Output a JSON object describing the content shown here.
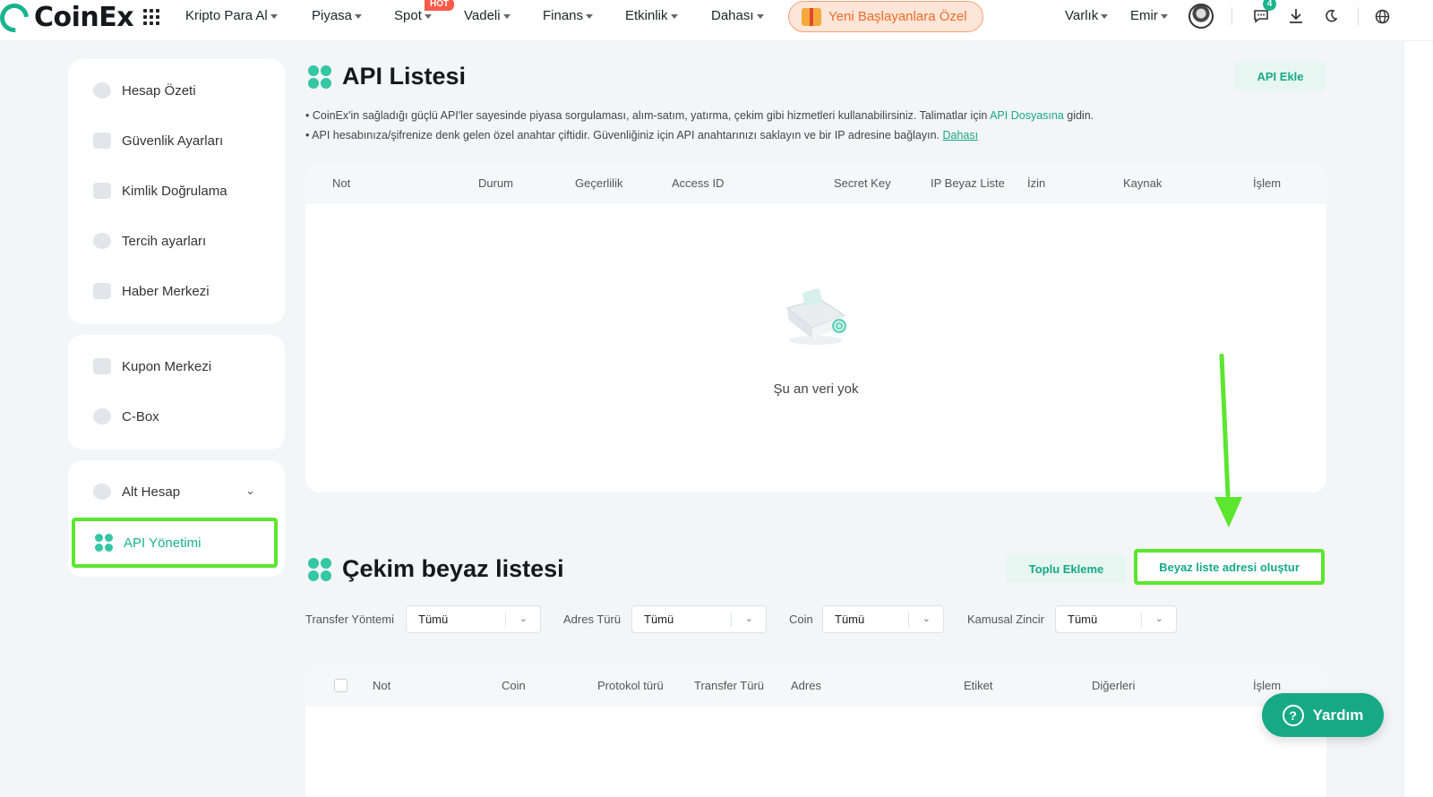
{
  "brand": {
    "name": "CoinEx",
    "accent": "#19b48e",
    "highlight": "#5be630"
  },
  "nav": {
    "items": [
      "Kripto Para Al",
      "Piyasa",
      "Spot",
      "Vadeli",
      "Finans",
      "Etkinlik",
      "Dahası"
    ],
    "hot_badge": "HOT",
    "promo": "Yeni Başlayanlara Özel",
    "asset": "Varlık",
    "order": "Emir",
    "notification_count": "4"
  },
  "sidebar": {
    "group1": [
      "Hesap Özeti",
      "Güvenlik Ayarları",
      "Kimlik Doğrulama",
      "Tercih ayarları",
      "Haber Merkezi"
    ],
    "group2": [
      "Kupon Merkezi",
      "C-Box"
    ],
    "subaccount": "Alt Hesap",
    "active": "API Yönetimi"
  },
  "api_list": {
    "title": "API Listesi",
    "add_button": "API Ekle",
    "info1_prefix": "• CoinEx'in sağladığı güçlü API'ler sayesinde piyasa sorgulaması, alım-satım, yatırma, çekim gibi hizmetleri kullanabilirsiniz. Talimatlar için ",
    "info1_link": "API Dosyasına",
    "info1_suffix": " gidin.",
    "info2_prefix": "• API hesabınıza/şifrenize denk gelen özel anahtar çiftidir. Güvenliğiniz için API anahtarınızı saklayın ve bir IP adresine bağlayın. ",
    "info2_link": "Dahası",
    "columns": [
      "Not",
      "Durum",
      "Geçerlilik",
      "Access ID",
      "Secret Key",
      "IP Beyaz Liste",
      "İzin",
      "Kaynak",
      "İşlem"
    ],
    "empty": "Şu an veri yok"
  },
  "whitelist": {
    "title": "Çekim beyaz listesi",
    "bulk_button": "Toplu Ekleme",
    "create_button": "Beyaz liste adresi oluştur",
    "filters": [
      {
        "label": "Transfer Yöntemi",
        "value": "Tümü"
      },
      {
        "label": "Adres Türü",
        "value": "Tümü"
      },
      {
        "label": "Coin",
        "value": "Tümü"
      },
      {
        "label": "Kamusal Zincir",
        "value": "Tümü"
      }
    ],
    "columns": [
      "Not",
      "Coin",
      "Protokol türü",
      "Transfer Türü",
      "Adres",
      "Etiket",
      "Diğerleri",
      "İşlem"
    ]
  },
  "help": {
    "label": "Yardım",
    "icon": "?"
  }
}
